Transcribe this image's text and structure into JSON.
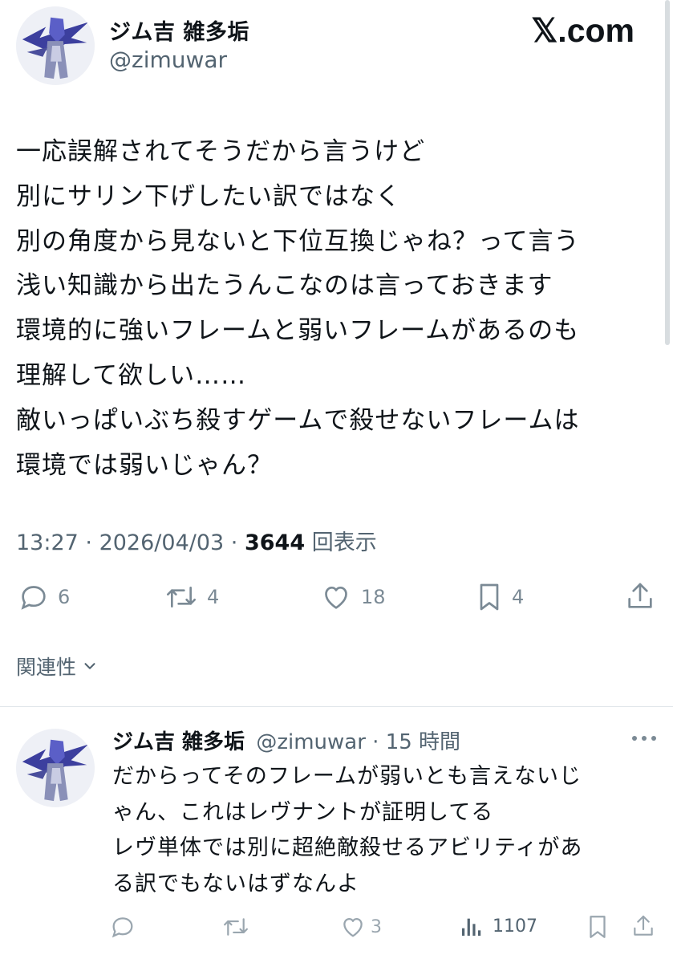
{
  "brand": "𝕏.com",
  "post": {
    "author_name": "ジム吉 雑多垢",
    "author_handle": "@zimuwar",
    "lines": [
      "一応誤解されてそうだから言うけど",
      "別にサリン下げしたい訳ではなく",
      "別の角度から見ないと下位互換じゃね？って言う",
      "浅い知識から出たうんこなのは言っておきます",
      "環境的に強いフレームと弱いフレームがあるのも",
      "理解して欲しい……",
      "敵いっぱいぶち殺すゲームで殺せないフレームは",
      "環境では弱いじゃん？"
    ],
    "time": "13:27",
    "date": "2026/04/03",
    "views": "3644",
    "views_label": "回表示",
    "stats": {
      "replies": "6",
      "reposts": "4",
      "likes": "18",
      "bookmarks": "4"
    }
  },
  "related": {
    "label": "関連性"
  },
  "reply": {
    "author_name": "ジム吉 雑多垢",
    "author_handle": "@zimuwar",
    "time_ago": "15 時間",
    "lines": [
      "だからってそのフレームが弱いとも言えないじ",
      "ゃん、これはレヴナントが証明してる",
      "レヴ単体では別に超絶敵殺せるアビリティがあ",
      "る訳でもないはずなんよ"
    ],
    "stats": {
      "replies": "",
      "reposts": "",
      "likes": "3",
      "views": "1107"
    }
  },
  "colors": {
    "text": "#0f1419",
    "muted": "#536471",
    "icon": "#7b8a95",
    "divider": "#e1e6ea"
  },
  "icons": [
    "reply-icon",
    "repost-icon",
    "like-icon",
    "bookmark-icon",
    "share-icon",
    "views-icon",
    "more-icon",
    "chevron-down-icon"
  ]
}
